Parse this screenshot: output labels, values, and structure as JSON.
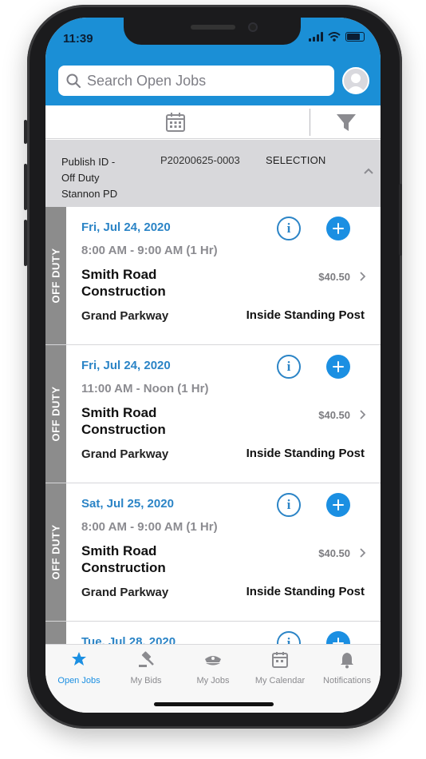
{
  "status": {
    "time": "11:39"
  },
  "search": {
    "placeholder": "Search Open Jobs"
  },
  "publish": {
    "label_line1": "Publish ID -",
    "label_line2": "Off Duty",
    "label_line3": "Stannon PD",
    "id": "P20200625-0003",
    "selection": "SELECTION"
  },
  "jobs": [
    {
      "tag": "OFF DUTY",
      "date": "Fri, Jul 24, 2020",
      "time": "8:00 AM - 9:00 AM (1 Hr)",
      "title_line1": "Smith Road",
      "title_line2": "Construction",
      "price": "$40.50",
      "location": "Grand Parkway",
      "post": "Inside Standing Post"
    },
    {
      "tag": "OFF DUTY",
      "date": "Fri, Jul 24, 2020",
      "time": "11:00 AM - Noon (1 Hr)",
      "title_line1": "Smith Road",
      "title_line2": "Construction",
      "price": "$40.50",
      "location": "Grand Parkway",
      "post": "Inside Standing Post"
    },
    {
      "tag": "OFF DUTY",
      "date": "Sat, Jul 25, 2020",
      "time": "8:00 AM - 9:00 AM (1 Hr)",
      "title_line1": "Smith Road",
      "title_line2": "Construction",
      "price": "$40.50",
      "location": "Grand Parkway",
      "post": "Inside Standing Post"
    },
    {
      "tag": "",
      "date": "Tue, Jul 28, 2020",
      "time": "",
      "title_line1": "",
      "title_line2": "",
      "price": "",
      "location": "",
      "post": ""
    }
  ],
  "tabs": [
    {
      "label": "Open Jobs",
      "icon": "star-badge-icon",
      "active": true
    },
    {
      "label": "My Bids",
      "icon": "gavel-icon",
      "active": false
    },
    {
      "label": "My Jobs",
      "icon": "police-cap-icon",
      "active": false
    },
    {
      "label": "My Calendar",
      "icon": "calendar-icon",
      "active": false
    },
    {
      "label": "Notifications",
      "icon": "bell-icon",
      "active": false
    }
  ],
  "colors": {
    "header": "#1b8fd6",
    "accent": "#2b84c6",
    "add_button": "#1b8fe2",
    "side_tag": "#8c8c8c"
  }
}
